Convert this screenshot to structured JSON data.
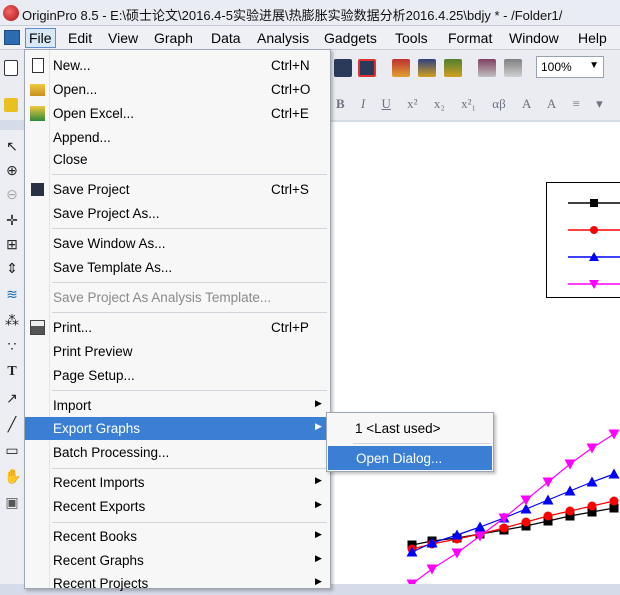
{
  "window": {
    "title": "OriginPro 8.5 - E:\\硕士论文\\2016.4-5实验进展\\热膨胀实验数据分析2016.4.25\\bdjy * - /Folder1/"
  },
  "menubar": {
    "items": [
      "File",
      "Edit",
      "View",
      "Graph",
      "Data",
      "Analysis",
      "Gadgets",
      "Tools",
      "Format",
      "Window",
      "Help"
    ],
    "active": "File"
  },
  "toolbar": {
    "zoom": "100%"
  },
  "format_toolbar": {
    "buttons": [
      "B",
      "I",
      "U",
      "x²",
      "x₂",
      "x²₁",
      "αβ",
      "A",
      "A",
      "≡",
      "▾"
    ]
  },
  "file_menu": {
    "items": [
      {
        "label": "New...",
        "shortcut": "Ctrl+N",
        "icon": "new-doc-icon"
      },
      {
        "label": "Open...",
        "shortcut": "Ctrl+O",
        "icon": "open-folder-icon"
      },
      {
        "label": "Open Excel...",
        "shortcut": "Ctrl+E",
        "icon": "excel-icon"
      },
      {
        "label": "Append..."
      },
      {
        "label": "Close"
      },
      {
        "label": "Save Project",
        "shortcut": "Ctrl+S",
        "icon": "save-icon"
      },
      {
        "label": "Save Project As..."
      },
      {
        "label": "Save Window As..."
      },
      {
        "label": "Save Template As..."
      },
      {
        "label": "Save Project As Analysis Template..."
      },
      {
        "label": "Print...",
        "shortcut": "Ctrl+P",
        "icon": "print-icon"
      },
      {
        "label": "Print Preview"
      },
      {
        "label": "Page Setup..."
      },
      {
        "label": "Import"
      },
      {
        "label": "Export Graphs"
      },
      {
        "label": "Batch Processing..."
      },
      {
        "label": "Recent Imports"
      },
      {
        "label": "Recent Exports"
      },
      {
        "label": "Recent Books"
      },
      {
        "label": "Recent Graphs"
      },
      {
        "label": "Recent Projects"
      }
    ]
  },
  "export_submenu": {
    "items": [
      {
        "label": "1 <Last used>"
      },
      {
        "label": "Open Dialog..."
      }
    ]
  },
  "colors": {
    "highlight": "#3a7fd4",
    "series": [
      "#000000",
      "#ff0000",
      "#0000ff",
      "#ff00ff"
    ]
  },
  "left_tools": [
    "pointer-icon",
    "zoom-in-icon",
    "zoom-out-icon",
    "screen-reader-icon",
    "data-reader-icon",
    "data-selector-icon",
    "draw-data-icon",
    "regional-mask-icon",
    "mask-points-icon",
    "text-tool-icon",
    "arrow-tool-icon",
    "line-tool-icon",
    "rectangle-tool-icon",
    "hand-icon",
    "graph-icon"
  ]
}
